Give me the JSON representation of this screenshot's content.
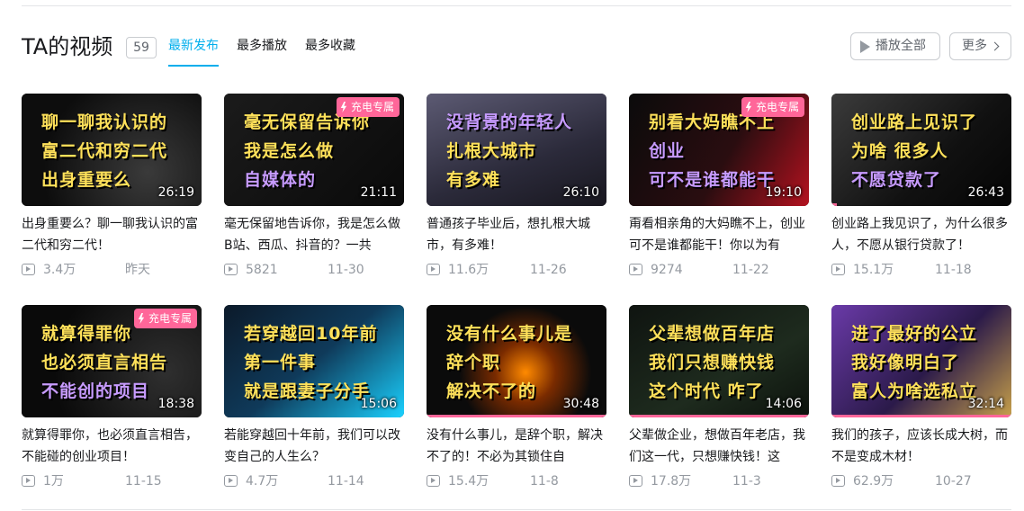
{
  "header": {
    "title": "TA的视频",
    "count": "59",
    "tabs": [
      {
        "label": "最新发布",
        "active": true
      },
      {
        "label": "最多播放",
        "active": false
      },
      {
        "label": "最多收藏",
        "active": false
      }
    ],
    "play_all_label": "播放全部",
    "more_label": "更多"
  },
  "colors": {
    "accent": "#00aeec",
    "badge": "#ff6699",
    "meta": "#9499a0"
  },
  "videos": [
    {
      "title": "出身重要么？聊一聊我认识的富二代和穷二代！",
      "plays": "3.4万",
      "date": "昨天",
      "duration": "26:19",
      "badge": "",
      "lines": [
        {
          "t": "聊一聊我认识的",
          "c": "c-yellow"
        },
        {
          "t": "富二代和穷二代",
          "c": "c-yellow"
        },
        {
          "t": "出身重要么",
          "c": "c-yellow"
        }
      ],
      "progress": 0
    },
    {
      "title": "毫无保留地告诉你，我是怎么做B站、西瓜、抖音的？一共",
      "plays": "5821",
      "date": "11-30",
      "duration": "21:11",
      "badge": "充电专属",
      "lines": [
        {
          "t": "毫无保留告诉你",
          "c": "c-yellow"
        },
        {
          "t": "我是怎么做",
          "c": "c-yellow"
        },
        {
          "t": "自媒体的",
          "c": "c-purple"
        }
      ],
      "progress": 0
    },
    {
      "title": "普通孩子毕业后，想扎根大城市，有多难！",
      "plays": "11.6万",
      "date": "11-26",
      "duration": "26:10",
      "badge": "",
      "lines": [
        {
          "t": "没背景的年轻人",
          "c": "c-purple"
        },
        {
          "t": "扎根大城市",
          "c": "c-yellow"
        },
        {
          "t": "有多难",
          "c": "c-yellow"
        }
      ],
      "progress": 0
    },
    {
      "title": "甭看相亲角的大妈瞧不上，创业可不是谁都能干！你以为有",
      "plays": "9274",
      "date": "11-22",
      "duration": "19:10",
      "badge": "充电专属",
      "lines": [
        {
          "t": "别看大妈瞧不上",
          "c": "c-yellow"
        },
        {
          "t": "创业",
          "c": "c-purple"
        },
        {
          "t": "可不是谁都能干",
          "c": "c-purple"
        }
      ],
      "progress": 0
    },
    {
      "title": "创业路上我见识了，为什么很多人，不愿从银行贷款了！",
      "plays": "15.1万",
      "date": "11-18",
      "duration": "26:43",
      "badge": "",
      "lines": [
        {
          "t": "创业路上见识了",
          "c": "c-yellow"
        },
        {
          "t": "为啥  很多人",
          "c": "c-yellow"
        },
        {
          "t": "不愿贷款了",
          "c": "c-purple"
        }
      ],
      "progress": 0.03
    },
    {
      "title": "就算得罪你，也必须直言相告，不能碰的创业项目！",
      "plays": "1万",
      "date": "11-15",
      "duration": "18:38",
      "badge": "充电专属",
      "lines": [
        {
          "t": "就算得罪你",
          "c": "c-yellow"
        },
        {
          "t": "也必须直言相告",
          "c": "c-yellow"
        },
        {
          "t": "不能创的项目",
          "c": "c-purple"
        }
      ],
      "progress": 0
    },
    {
      "title": "若能穿越回十年前，我们可以改变自己的人生么？",
      "plays": "4.7万",
      "date": "11-14",
      "duration": "15:06",
      "badge": "",
      "lines": [
        {
          "t": "若穿越回10年前",
          "c": "c-yellow"
        },
        {
          "t": "第一件事",
          "c": "c-yellow"
        },
        {
          "t": "就是跟妻子分手",
          "c": "c-yellow"
        }
      ],
      "progress": 0
    },
    {
      "title": "没有什么事儿，是辞个职，解决不了的！不必为其锁住自",
      "plays": "15.4万",
      "date": "11-8",
      "duration": "30:48",
      "badge": "",
      "lines": [
        {
          "t": "没有什么事儿是",
          "c": "c-yellow"
        },
        {
          "t": "辞个职",
          "c": "c-yellow"
        },
        {
          "t": "解决不了的",
          "c": "c-yellow"
        }
      ],
      "progress": 1
    },
    {
      "title": "父辈做企业，想做百年老店，我们这一代，只想赚快钱！这",
      "plays": "17.8万",
      "date": "11-3",
      "duration": "14:06",
      "badge": "",
      "lines": [
        {
          "t": "父辈想做百年店",
          "c": "c-yellow"
        },
        {
          "t": "我们只想赚快钱",
          "c": "c-yellow"
        },
        {
          "t": "这个时代  咋了",
          "c": "c-yellow"
        }
      ],
      "progress": 1
    },
    {
      "title": "我们的孩子，应该长成大树，而不是变成木材！",
      "plays": "62.9万",
      "date": "10-27",
      "duration": "32:14",
      "badge": "",
      "lines": [
        {
          "t": "进了最好的公立",
          "c": "c-yellow"
        },
        {
          "t": "我好像明白了",
          "c": "c-yellow"
        },
        {
          "t": "富人为啥选私立",
          "c": "c-yellow"
        }
      ],
      "progress": 1
    }
  ]
}
